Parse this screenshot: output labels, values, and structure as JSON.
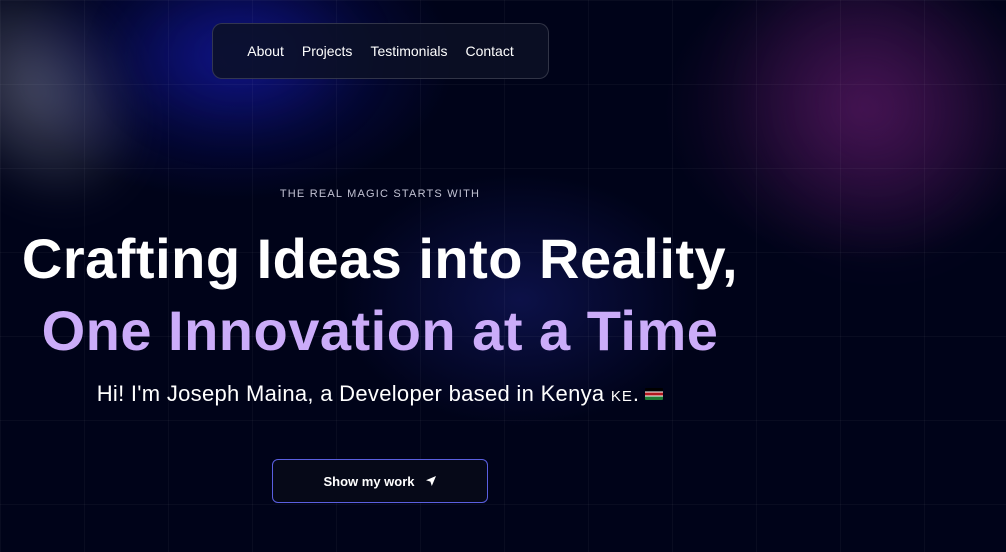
{
  "nav": {
    "items": [
      {
        "label": "About"
      },
      {
        "label": "Projects"
      },
      {
        "label": "Testimonials"
      },
      {
        "label": "Contact"
      }
    ]
  },
  "hero": {
    "eyebrow": "THE REAL MAGIC STARTS WITH",
    "headline": "Crafting Ideas into Reality,",
    "headline_accent": "One Innovation at a Time",
    "intro": "Hi! I'm Joseph Maina, a Developer based in Kenya ",
    "country_code": "KE",
    "intro_end": ".",
    "cta_label": "Show my work",
    "cta_icon": "location-arrow-icon",
    "flag_icon": "kenya-flag-icon"
  },
  "colors": {
    "background": "#000319",
    "accent_purple": "#cbacf9",
    "button_border": "#5a5fe0"
  }
}
